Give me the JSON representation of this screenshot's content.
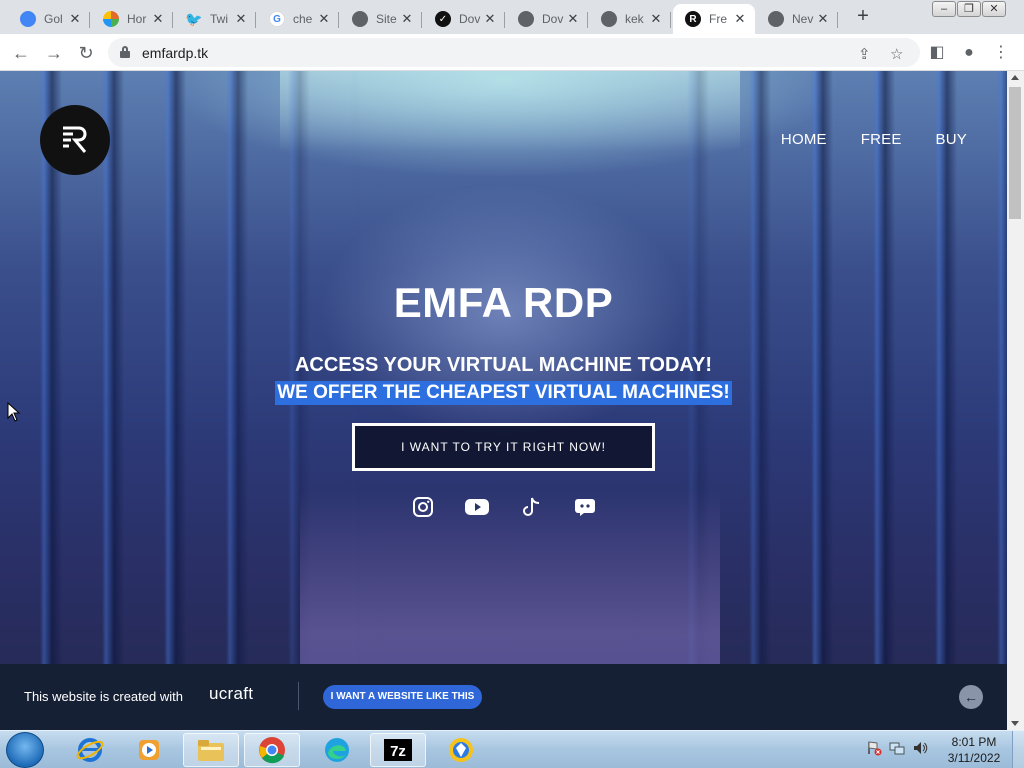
{
  "browser": {
    "tabs": [
      {
        "title": "Gol",
        "favicon": "google-globe-icon",
        "color": "#4285f4"
      },
      {
        "title": "Hor",
        "favicon": "colorful-icon",
        "color": "#e06b2b"
      },
      {
        "title": "Twi",
        "favicon": "twitter-icon",
        "color": "#1d9bf0"
      },
      {
        "title": "che",
        "favicon": "google-g-icon",
        "color": "#4285f4"
      },
      {
        "title": "Site",
        "favicon": "globe-icon",
        "color": "#5f6368"
      },
      {
        "title": "Dov",
        "favicon": "check-circle-icon",
        "color": "#111111"
      },
      {
        "title": "Dov",
        "favicon": "globe-icon",
        "color": "#5f6368"
      },
      {
        "title": "kek",
        "favicon": "globe-icon",
        "color": "#5f6368"
      },
      {
        "title": "Fre",
        "favicon": "emfa-logo-icon",
        "color": "#111111",
        "active": true
      },
      {
        "title": "Nev",
        "favicon": "chrome-icon",
        "color": "#5f6368"
      }
    ],
    "new_tab_label": "+",
    "url": "emfardp.tk"
  },
  "site": {
    "nav": [
      "HOME",
      "FREE",
      "BUY"
    ],
    "title": "EMFA RDP",
    "tagline1": "ACCESS YOUR VIRTUAL MACHINE TODAY!",
    "tagline2": "WE OFFER THE CHEAPEST VIRTUAL MACHINES!",
    "cta": "I WANT TO TRY IT RIGHT NOW!",
    "socials": [
      "instagram-icon",
      "youtube-icon",
      "tiktok-icon",
      "discord-icon"
    ]
  },
  "ucraft": {
    "made_with": "This website is created with",
    "brand": "ucraft",
    "button": "I WANT A WEBSITE LIKE THIS"
  },
  "taskbar": {
    "time": "8:01 PM",
    "date": "3/11/2022"
  },
  "colors": {
    "accent_highlight": "#2e6fe0",
    "ucraft_button": "#2f67d9",
    "ucraft_bar": "#162034"
  }
}
